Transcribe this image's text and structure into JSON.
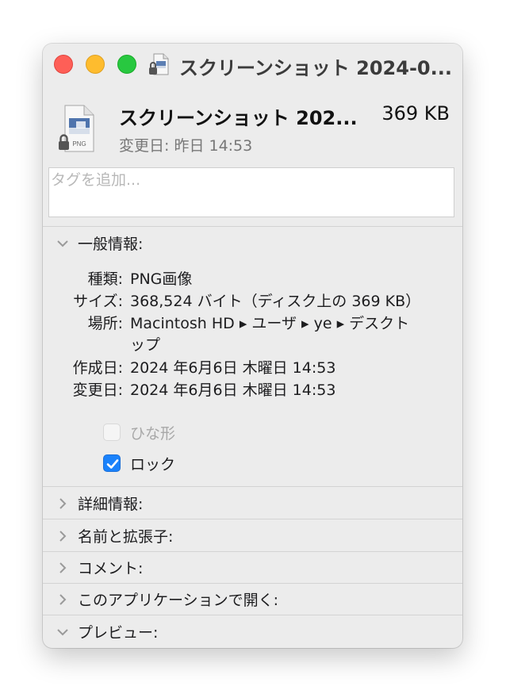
{
  "window": {
    "title": "スクリーンショット 2024-0..."
  },
  "header": {
    "file_name": "スクリーンショット 202...",
    "file_size": "369 KB",
    "modified": "変更日: 昨日 14:53",
    "file_icon_label": "PNG"
  },
  "tags": {
    "placeholder": "タグを追加..."
  },
  "general": {
    "label": "一般情報:",
    "kind_label": "種類:",
    "kind_value": "PNG画像",
    "size_label": "サイズ:",
    "size_value": "368,524 バイト（ディスク上の 369 KB）",
    "where_label": "場所:",
    "where_value_line1": "Macintosh HD ▸ ユーザ ▸ ye ▸ デスクト",
    "where_value_line2": "ップ",
    "created_label": "作成日:",
    "created_value": "2024 年6月6日 木曜日 14:53",
    "modified_label": "変更日:",
    "modified_value": "2024 年6月6日 木曜日 14:53",
    "stationery_label": "ひな形",
    "stationery_checked": false,
    "locked_label": "ロック",
    "locked_checked": true
  },
  "sections": {
    "more_info": "詳細情報:",
    "name_ext": "名前と拡張子:",
    "comments": "コメント:",
    "open_with": "このアプリケーションで開く:",
    "preview": "プレビュー:"
  },
  "colors": {
    "accent": "#1a82fb",
    "close": "#fe5f57",
    "minimize": "#febc2e",
    "zoom": "#28c840"
  }
}
